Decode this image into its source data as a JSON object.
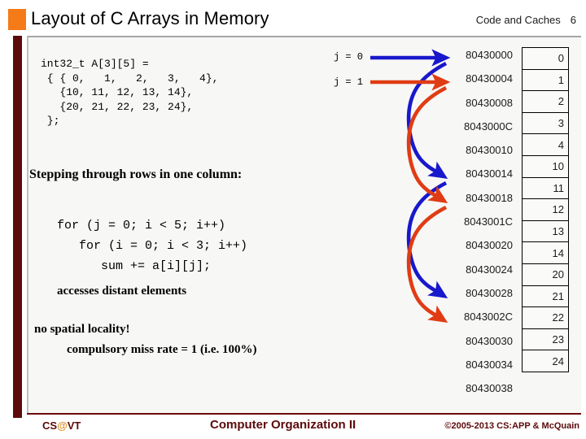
{
  "header": {
    "title": "Layout of C Arrays in Memory",
    "course_label": "Code and Caches",
    "page_number": "6"
  },
  "code_declaration": "int32_t A[3][5] =\n { { 0,   1,   2,   3,   4},\n   {10, 11, 12, 13, 14},\n   {20, 21, 22, 23, 24},\n };",
  "prose": {
    "heading": "Stepping through rows in one column:",
    "loop_code": "for (j = 0; i < 5; i++)\n   for (i = 0; i < 3; i++)\n      sum += a[i][j];",
    "note_a": "accesses distant elements",
    "note_b": "no spatial locality!",
    "note_c": "compulsory miss rate = 1 (i.e. 100%)"
  },
  "iteration_labels": [
    {
      "text": "j = 0",
      "color": "#1818CC"
    },
    {
      "text": "j = 1",
      "color": "#E03C14"
    }
  ],
  "memory": {
    "addresses": [
      "80430000",
      "80430004",
      "80430008",
      "8043000C",
      "80430010",
      "80430014",
      "80430018",
      "8043001C",
      "80430020",
      "80430024",
      "80430028",
      "8043002C",
      "80430030",
      "80430034",
      "80430038"
    ],
    "values": [
      "0",
      "1",
      "2",
      "3",
      "4",
      "10",
      "11",
      "12",
      "13",
      "14",
      "20",
      "21",
      "22",
      "23",
      "24"
    ]
  },
  "colors": {
    "accent_orange": "#F47B18",
    "maroon": "#5C0A0A",
    "arrow_blue": "#1818CC",
    "arrow_red": "#E03C14",
    "panel_bg": "#F7F7F5"
  },
  "footer": {
    "left_cs": "CS",
    "left_at": "@",
    "left_vt": "VT",
    "center": "Computer Organization II",
    "right": "©2005-2013 CS:APP & McQuain"
  }
}
